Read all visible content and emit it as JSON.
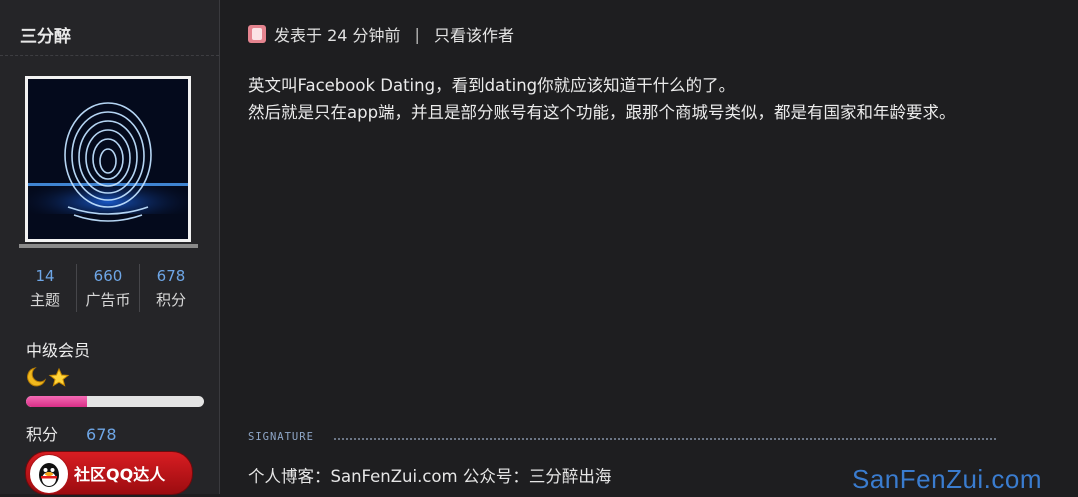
{
  "user": {
    "name": "三分醉",
    "stats": [
      {
        "value": "14",
        "label": "主题"
      },
      {
        "value": "660",
        "label": "广告币"
      },
      {
        "value": "678",
        "label": "积分"
      }
    ],
    "rank": "中级会员",
    "level_progress": 0.34,
    "points_label": "积分",
    "points_value": "678",
    "qq_button": "社区QQ达人"
  },
  "post": {
    "posted": "发表于 24 分钟前",
    "separator": "|",
    "only_author": "只看该作者",
    "lines": [
      "英文叫Facebook Dating，看到dating你就应该知道干什么的了。",
      "然后就是只在app端，并且是部分账号有这个功能，跟那个商城号类似，都是有国家和年龄要求。"
    ]
  },
  "signature": {
    "label": "SIGNATURE",
    "text": "个人博客：SanFenZui.com 公众号：三分醉出海"
  },
  "watermark": "SanFenZui.com",
  "colors": {
    "background": "#1e1e20",
    "sidebar": "#252528",
    "link_blue": "#6ea6e6",
    "progress_pink": "#e8449a",
    "qq_red": "#c6161b"
  }
}
